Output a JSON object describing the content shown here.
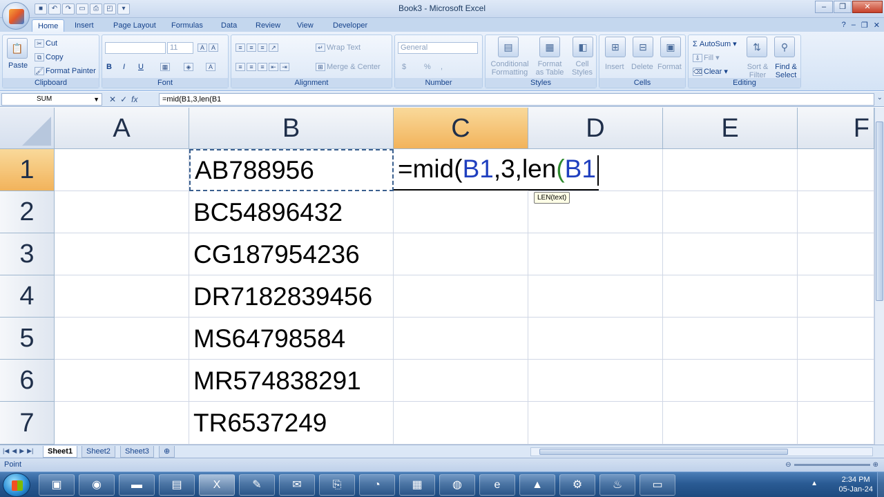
{
  "window": {
    "title": "Book3 - Microsoft Excel",
    "buttons": {
      "minimize": "–",
      "restore": "❐",
      "close": "✕"
    }
  },
  "ribbon_tabs": [
    "Home",
    "Insert",
    "Page Layout",
    "Formulas",
    "Data",
    "Review",
    "View",
    "Developer"
  ],
  "ribbon": {
    "clipboard": {
      "paste": "Paste",
      "cut": "Cut",
      "copy": "Copy",
      "format_painter": "Format Painter",
      "label": "Clipboard"
    },
    "font": {
      "font_name": "",
      "font_size": "11",
      "bold": "B",
      "italic": "I",
      "underline": "U",
      "label": "Font"
    },
    "alignment": {
      "wrap_text": "Wrap Text",
      "merge_center": "Merge & Center",
      "label": "Alignment"
    },
    "number": {
      "format": "General",
      "currency": "$",
      "percent": "%",
      "comma": ",",
      "label": "Number"
    },
    "styles": {
      "conditional": "Conditional",
      "conditional2": "Formatting",
      "format_table": "Format",
      "format_table2": "as Table",
      "cell_styles": "Cell",
      "cell_styles2": "Styles",
      "label": "Styles"
    },
    "cells": {
      "insert": "Insert",
      "delete": "Delete",
      "format": "Format",
      "label": "Cells"
    },
    "editing": {
      "autosum": "AutoSum",
      "fill": "Fill",
      "clear": "Clear",
      "sort_filter": "Sort &",
      "sort_filter2": "Filter",
      "find_select": "Find &",
      "find_select2": "Select",
      "label": "Editing"
    }
  },
  "formula_bar": {
    "name_box": "SUM",
    "cancel": "✕",
    "enter": "✓",
    "fx": "fx",
    "formula": "=mid(B1,3,len(B1"
  },
  "grid": {
    "columns": [
      "A",
      "B",
      "C",
      "D",
      "E",
      "F"
    ],
    "rows": [
      "1",
      "2",
      "3",
      "4",
      "5",
      "6",
      "7"
    ],
    "column_b": [
      "AB788956",
      "BC54896432",
      "CG187954236",
      "DR7182839456",
      "MS64798584",
      "MR574838291",
      "TR6537249"
    ],
    "edit": {
      "prefix": "=mid(",
      "ref1": "B1",
      "middle": ",3,len",
      "paren": "(",
      "ref2": "B1"
    },
    "tooltip": "LEN(text)"
  },
  "sheets": [
    "Sheet1",
    "Sheet2",
    "Sheet3"
  ],
  "status": {
    "mode": "Point"
  },
  "taskbar": {
    "time": "2:34 PM",
    "date": "05-Jan-24"
  }
}
